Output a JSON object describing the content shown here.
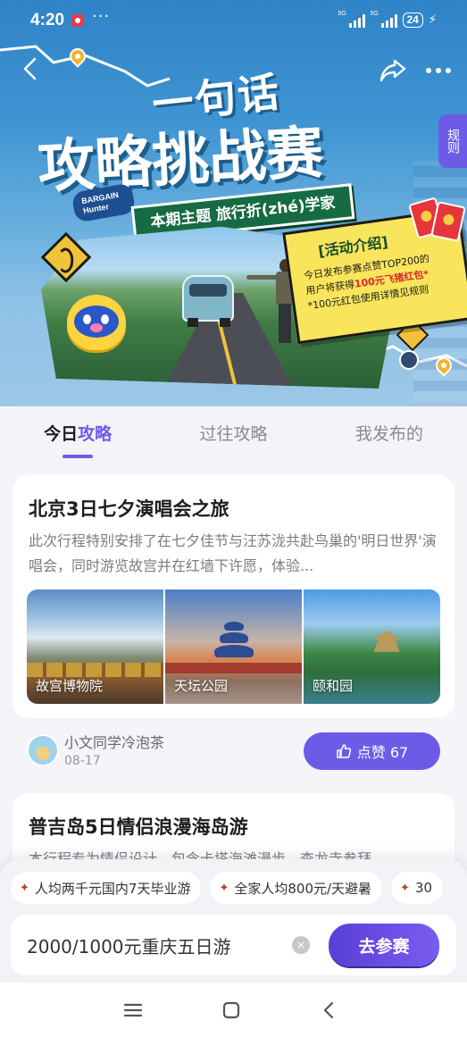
{
  "status": {
    "time": "4:20",
    "more": "···",
    "net1": "5G",
    "net2": "5G",
    "battery": "24",
    "charging": "⚡"
  },
  "hero": {
    "title_line1": "一句话",
    "title_line2": "攻略挑战赛",
    "brand": "BARGAIN Hunter",
    "theme": "本期主题 旅行折(zhé)学家",
    "rules_label": "规则",
    "intro": {
      "title": "[活动介绍]",
      "line1": "今日发布参赛点赞TOP200的",
      "line2_prefix": "用户将获得",
      "line2_highlight": "100元飞猪红包*",
      "line3": "*100元红包使用详情见规则"
    }
  },
  "tabs": [
    {
      "label_prefix": "今日",
      "label_highlight": "攻略",
      "active": true
    },
    {
      "label": "过往攻略",
      "active": false
    },
    {
      "label": "我发布的",
      "active": false
    }
  ],
  "cards": [
    {
      "title": "北京3日七夕演唱会之旅",
      "description": "此次行程特别安排了在七夕佳节与汪苏泷共赴鸟巢的'明日世界'演唱会，同时游览故宫并在红墙下许愿，体验...",
      "photos": [
        {
          "label": "故宫博物院"
        },
        {
          "label": "天坛公园"
        },
        {
          "label": "颐和园"
        }
      ],
      "author": {
        "name": "小文同学冷泡茶",
        "date": "08-17"
      },
      "like_label": "点赞 67"
    },
    {
      "title": "普吉岛5日情侣浪漫海岛游",
      "description": "本行程专为情侣设计，包含卡塔海滩漫步、查龙寺参拜..."
    }
  ],
  "composer": {
    "chips": [
      "人均两千元国内7天毕业游",
      "全家人均800元/天避暑",
      "30"
    ],
    "input_value": "2000/1000元重庆五日游",
    "clear_icon": "×",
    "submit_label": "去参赛"
  }
}
